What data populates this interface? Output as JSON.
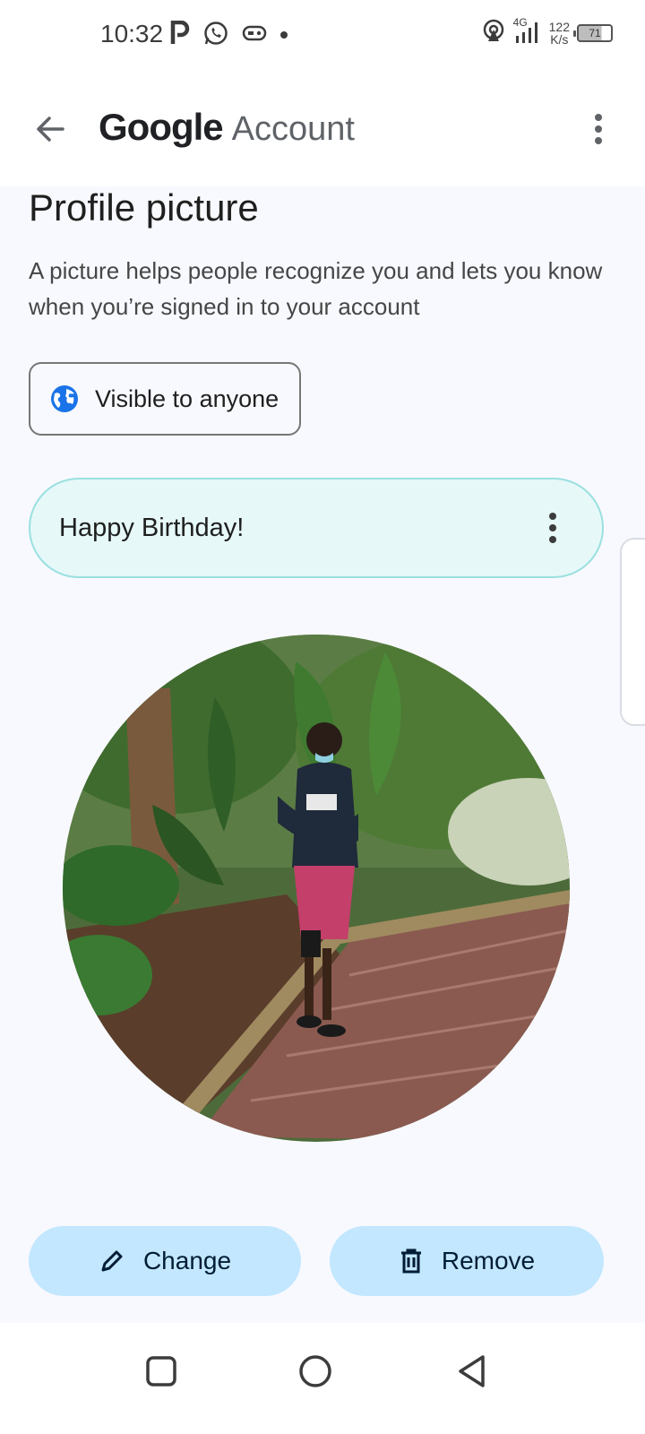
{
  "status_bar": {
    "time": "10:32",
    "network": "4G",
    "speed_value": "122",
    "speed_unit": "K/s",
    "battery": "71"
  },
  "app_bar": {
    "brand": "Google",
    "product": "Account"
  },
  "page": {
    "title": "Profile picture",
    "description": "A picture helps people recognize you and lets you know when you’re signed in to your account"
  },
  "visibility": {
    "label": "Visible to anyone"
  },
  "banner": {
    "label": "Happy Birthday!"
  },
  "actions": {
    "change_label": "Change",
    "remove_label": "Remove"
  },
  "icons": {
    "back": "arrow-back-icon",
    "more": "more-vert-icon",
    "globe": "globe-icon",
    "pencil": "pencil-icon",
    "trash": "trash-icon"
  },
  "colors": {
    "button_fill": "#c2e7ff",
    "banner_fill": "#e6f8f8",
    "banner_border": "#9be0e0",
    "globe_blue": "#1a73e8",
    "content_bg": "#f8f9fe"
  }
}
